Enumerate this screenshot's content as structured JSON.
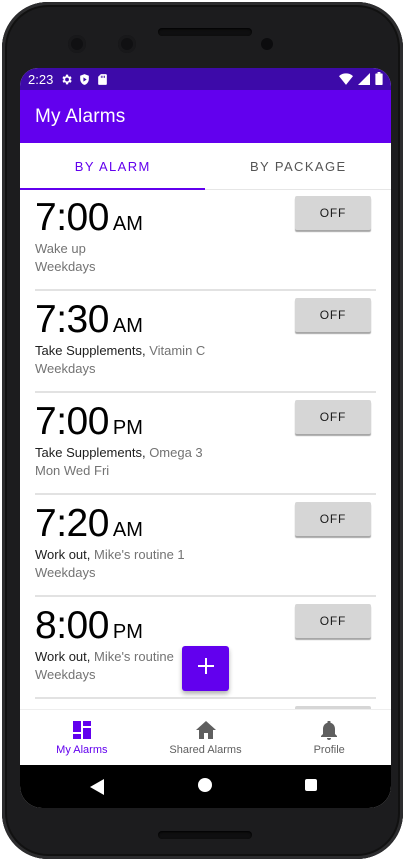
{
  "status_bar": {
    "time": "2:23"
  },
  "app_bar": {
    "title": "My Alarms"
  },
  "tabs": [
    {
      "label": "BY ALARM",
      "active": true
    },
    {
      "label": "BY PACKAGE",
      "active": false
    }
  ],
  "alarms": [
    {
      "time": "7:00",
      "period": "AM",
      "name": "Wake up",
      "detail": "",
      "days": "Weekdays",
      "button": "OFF"
    },
    {
      "time": "7:30",
      "period": "AM",
      "name": "Take Supplements,",
      "detail": " Vitamin C",
      "days": "Weekdays",
      "button": "OFF"
    },
    {
      "time": "7:00",
      "period": "PM",
      "name": "Take Supplements,",
      "detail": " Omega 3",
      "days": "Mon Wed Fri",
      "button": "OFF"
    },
    {
      "time": "7:20",
      "period": "AM",
      "name": "Work out,",
      "detail": " Mike's routine 1",
      "days": "Weekdays",
      "button": "OFF"
    },
    {
      "time": "8:00",
      "period": "PM",
      "name": "Work out,",
      "detail": " Mike's routine",
      "days": "Weekdays",
      "button": "OFF"
    }
  ],
  "fab": {
    "icon": "add-icon"
  },
  "bottom_nav": [
    {
      "label": "My Alarms",
      "icon": "dashboard-icon",
      "active": true
    },
    {
      "label": "Shared Alarms",
      "icon": "home-icon",
      "active": false
    },
    {
      "label": "Profile",
      "icon": "bell-icon",
      "active": false
    }
  ],
  "colors": {
    "primary": "#6200ee",
    "status_bar": "#3d0aa9"
  }
}
